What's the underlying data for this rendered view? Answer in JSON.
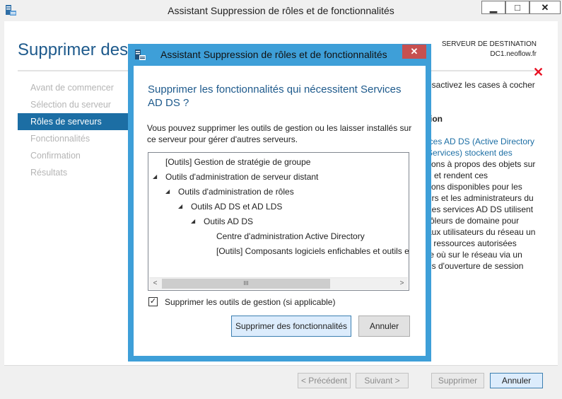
{
  "main_window": {
    "title": "Assistant Suppression de rôles et de fonctionnalités",
    "controls": {
      "minimize": "▁",
      "maximize": "□",
      "close": "✕"
    }
  },
  "page": {
    "title": "Supprimer des r",
    "destination_label": "SERVEUR DE DESTINATION",
    "destination_server": "DC1.neoflow.fr"
  },
  "nav": {
    "items": [
      {
        "label": "Avant de commencer",
        "active": false
      },
      {
        "label": "Sélection du serveur",
        "active": false
      },
      {
        "label": "Rôles de serveurs",
        "active": true
      },
      {
        "label": "Fonctionnalités",
        "active": false
      },
      {
        "label": "Confirmation",
        "active": false
      },
      {
        "label": "Résultats",
        "active": false
      }
    ]
  },
  "right_text": {
    "lines": [
      "ésactivez les cases à cocher",
      "",
      "",
      "tion",
      "",
      "ices AD DS (Active Directory",
      "Services) stockent des",
      "tions à propos des objets sur",
      "u et rendent ces",
      "tions disponibles pour les",
      "urs et les administrateurs du",
      "Les services AD DS utilisent",
      "rôleurs de domaine pour",
      "aux utilisateurs du réseau un",
      "x ressources autorisées",
      "te où sur le réseau via un",
      "us d'ouverture de session"
    ]
  },
  "bottom_buttons": {
    "previous": "< Précédent",
    "next": "Suivant >",
    "remove": "Supprimer",
    "cancel": "Annuler"
  },
  "dialog": {
    "title": "Assistant Suppression de rôles et de fonctionnalités",
    "close": "✕",
    "heading": "Supprimer les fonctionnalités qui nécessitent Services AD DS ?",
    "description": "Vous pouvez supprimer les outils de gestion ou les laisser installés sur ce serveur pour gérer d'autres serveurs.",
    "tree": [
      {
        "label": "[Outils] Gestion de stratégie de groupe",
        "level": 0,
        "expanded": false
      },
      {
        "label": "Outils d'administration de serveur distant",
        "level": 0,
        "expanded": true
      },
      {
        "label": "Outils d'administration de rôles",
        "level": 1,
        "expanded": true
      },
      {
        "label": "Outils AD DS et AD LDS",
        "level": 2,
        "expanded": true
      },
      {
        "label": "Outils AD DS",
        "level": 3,
        "expanded": true
      },
      {
        "label": "Centre d'administration Active Directory",
        "level": 4,
        "expanded": false
      },
      {
        "label": "[Outils] Composants logiciels enfichables et outils e",
        "level": 4,
        "expanded": false
      }
    ],
    "scroll_grip": "III",
    "checkbox_label": "Supprimer les outils de gestion (si applicable)",
    "checkbox_checked": true,
    "remove_features_button": "Supprimer des fonctionnalités",
    "cancel_button": "Annuler"
  },
  "colors": {
    "accent": "#1c6ea4",
    "dialog_border": "#3e9fd8",
    "close_red": "#c75050",
    "error_red": "#e81123"
  }
}
